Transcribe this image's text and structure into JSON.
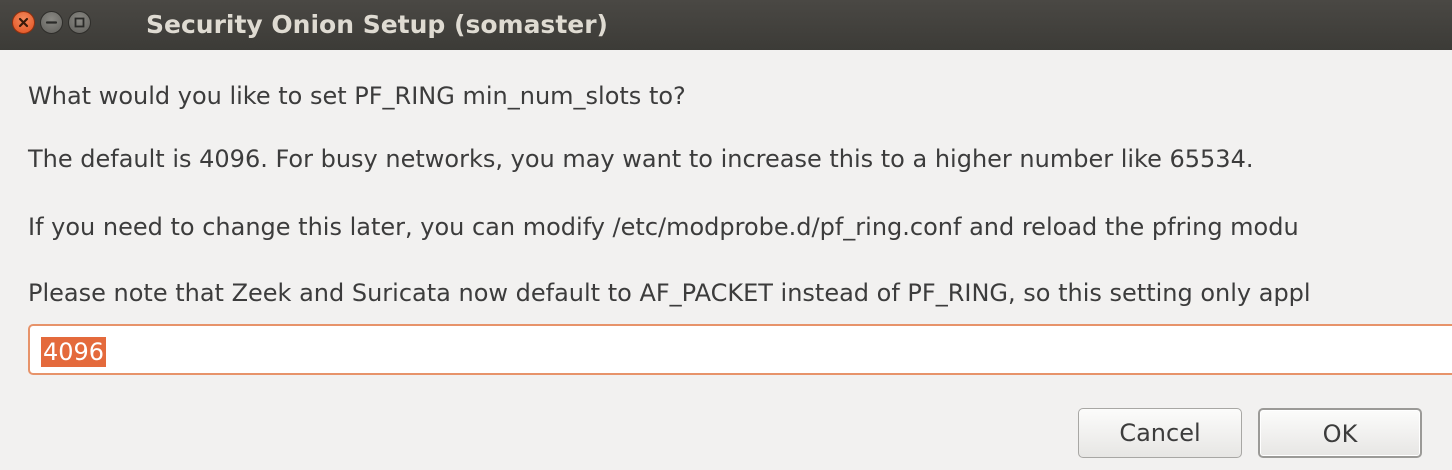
{
  "window": {
    "title": "Security Onion Setup (somaster)",
    "controls": {
      "close": "close-icon",
      "minimize": "minimize-icon",
      "maximize": "maximize-icon"
    }
  },
  "dialog": {
    "line1": "What would you like to set PF_RING min_num_slots to?",
    "line2": "The default is 4096.  For busy networks, you may want to increase this to a higher number like 65534.",
    "line3": "If you need to change this later, you can modify /etc/modprobe.d/pf_ring.conf and reload the pfring modu",
    "line4": "Please note that Zeek and Suricata now default to AF_PACKET instead of PF_RING, so this setting only appl",
    "entry_value": "4096"
  },
  "buttons": {
    "cancel_label": "Cancel",
    "ok_label": "OK"
  },
  "colors": {
    "titlebar": "#3c3b37",
    "accent": "#e46a3c",
    "background": "#f2f1f0"
  }
}
